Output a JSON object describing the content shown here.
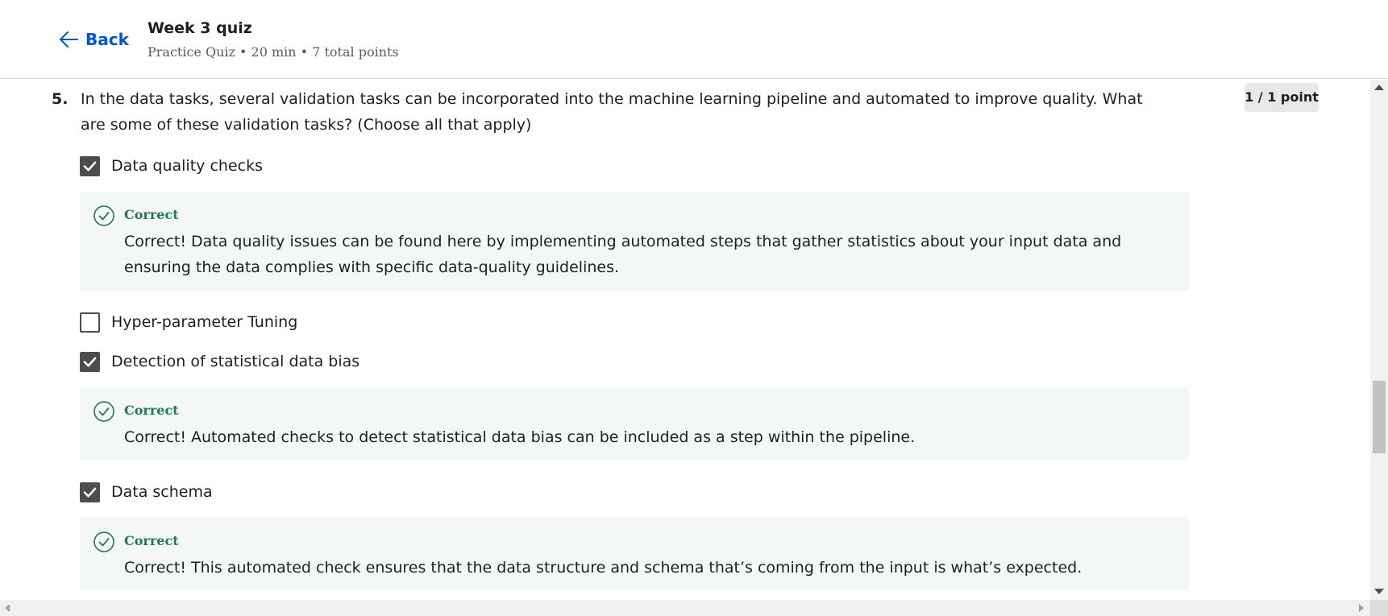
{
  "header": {
    "back_label": "Back",
    "title": "Week 3 quiz",
    "meta": "Practice Quiz • 20 min • 7 total points"
  },
  "question": {
    "number": "5.",
    "text": "In the data tasks, several validation tasks can be incorporated into the machine learning pipeline and automated to improve quality. What are some of these validation tasks? (Choose all that apply)",
    "points": "1 / 1 point",
    "options": [
      {
        "label": "Data quality checks",
        "checked": true,
        "feedback": {
          "title": "Correct",
          "text": "Correct! Data quality issues can be found here by implementing automated steps that gather statistics about your input data and ensuring the data complies with specific data-quality guidelines."
        }
      },
      {
        "label": "Hyper-parameter Tuning",
        "checked": false
      },
      {
        "label": "Detection of statistical data bias",
        "checked": true,
        "feedback": {
          "title": "Correct",
          "text": "Correct! Automated checks to detect statistical data bias can be included as a step within the pipeline."
        }
      },
      {
        "label": "Data schema",
        "checked": true,
        "feedback": {
          "title": "Correct",
          "text": "Correct! This automated check ensures that the data structure and schema that’s coming from the input is what’s expected."
        }
      }
    ]
  },
  "colors": {
    "accent": "#0056d2",
    "correct": "#1f7a53",
    "feedback_bg": "#f3f8f6",
    "checkbox": "#4d4d4d"
  },
  "icons": {
    "back": "arrow-left-icon",
    "check": "checkmark-icon",
    "feedback": "check-circle-icon"
  }
}
